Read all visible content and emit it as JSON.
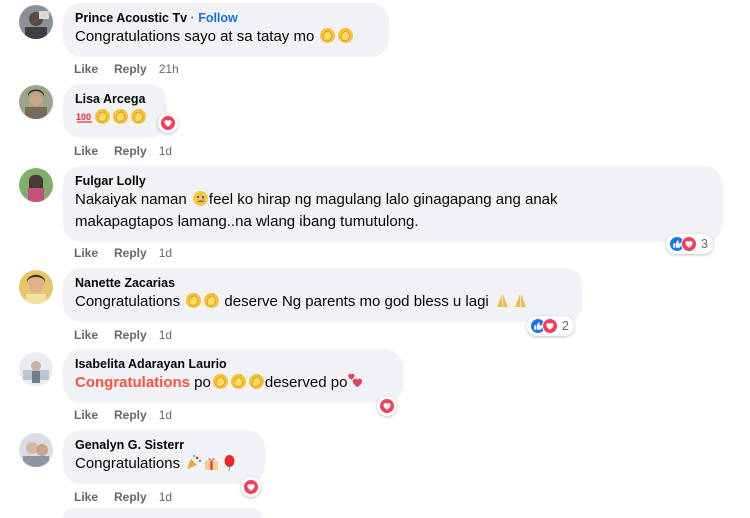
{
  "comments": [
    {
      "author": "Prince Acoustic Tv",
      "follow_sep": " · ",
      "follow": "Follow",
      "text": "Congratulations sayo at sa tatay mo",
      "like": "Like",
      "reply": "Reply",
      "time": "21h"
    },
    {
      "author": "Lisa Arcega",
      "text": "",
      "like": "Like",
      "reply": "Reply",
      "time": "1d"
    },
    {
      "author": "Fulgar Lolly",
      "text_line1": "Nakaiyak naman",
      "text_line1b": "feel ko hirap ng magulang lalo ginagapang ang anak",
      "text_line2": "makapagtapos lamang..na wlang ibang tumutulong.",
      "like": "Like",
      "reply": "Reply",
      "time": "1d",
      "reaction_count": "3"
    },
    {
      "author": "Nanette Zacarias",
      "text_a": "Congratulations",
      "text_b": "deserve Ng parents mo god bless u lagi",
      "like": "Like",
      "reply": "Reply",
      "time": "1d",
      "reaction_count": "2"
    },
    {
      "author": "Isabelita Adarayan Laurio",
      "text_highlight": "Congratulations",
      "text_a": " po",
      "text_b": "deserved po",
      "like": "Like",
      "reply": "Reply",
      "time": "1d"
    },
    {
      "author": "Genalyn G. Sisterr",
      "text": "Congratulations",
      "like": "Like",
      "reply": "Reply",
      "time": "1d"
    }
  ],
  "colors": {
    "bubble": "#f0f2f5",
    "follow": "#216fdb",
    "meta": "#65676b",
    "like_reaction": "#1877f2",
    "love_reaction": "#f33e58",
    "highlight": "#f7533a"
  }
}
